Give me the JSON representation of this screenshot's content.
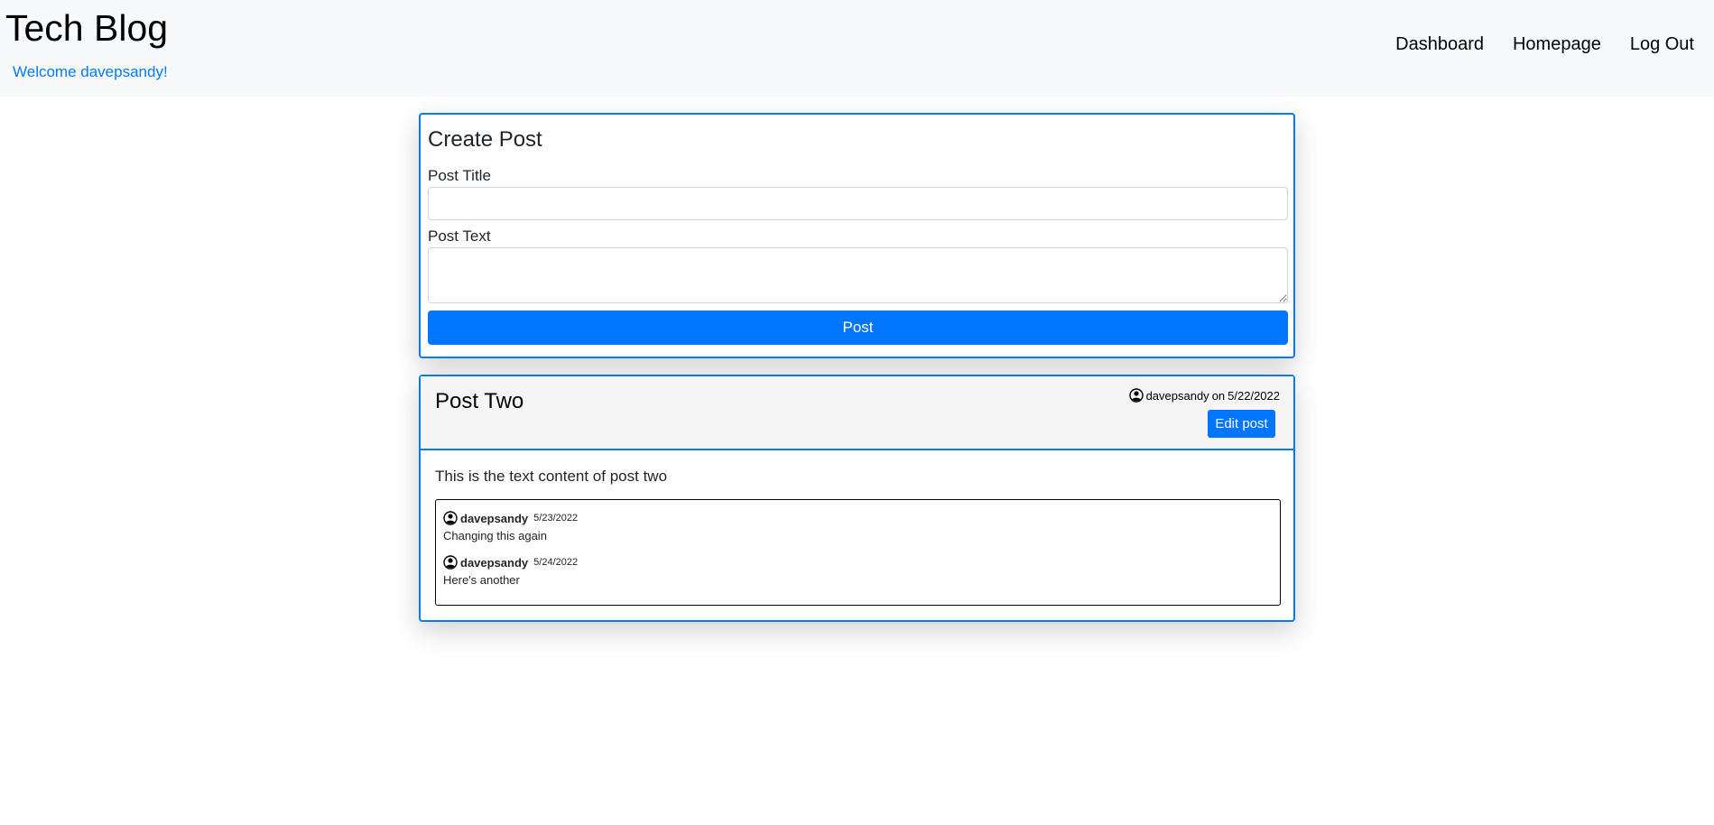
{
  "header": {
    "brand": "Tech Blog",
    "welcome": "Welcome davepsandy!",
    "nav": [
      "Dashboard",
      "Homepage",
      "Log Out"
    ]
  },
  "create_post": {
    "title": "Create Post",
    "title_label": "Post Title",
    "title_value": "",
    "text_label": "Post Text",
    "text_value": "",
    "submit": "Post"
  },
  "post": {
    "title": "Post Two",
    "author": "davepsandy",
    "on": "on",
    "date": "5/22/2022",
    "edit": "Edit post",
    "content": "This is the text content of post two",
    "comments": [
      {
        "author": "davepsandy",
        "date": "5/23/2022",
        "text": "Changing this again"
      },
      {
        "author": "davepsandy",
        "date": "5/24/2022",
        "text": "Here's another"
      }
    ]
  },
  "colors": {
    "accent": "#007bff",
    "header_bg": "#f8f9fa"
  },
  "icons": {
    "user": "user-circle-icon"
  }
}
